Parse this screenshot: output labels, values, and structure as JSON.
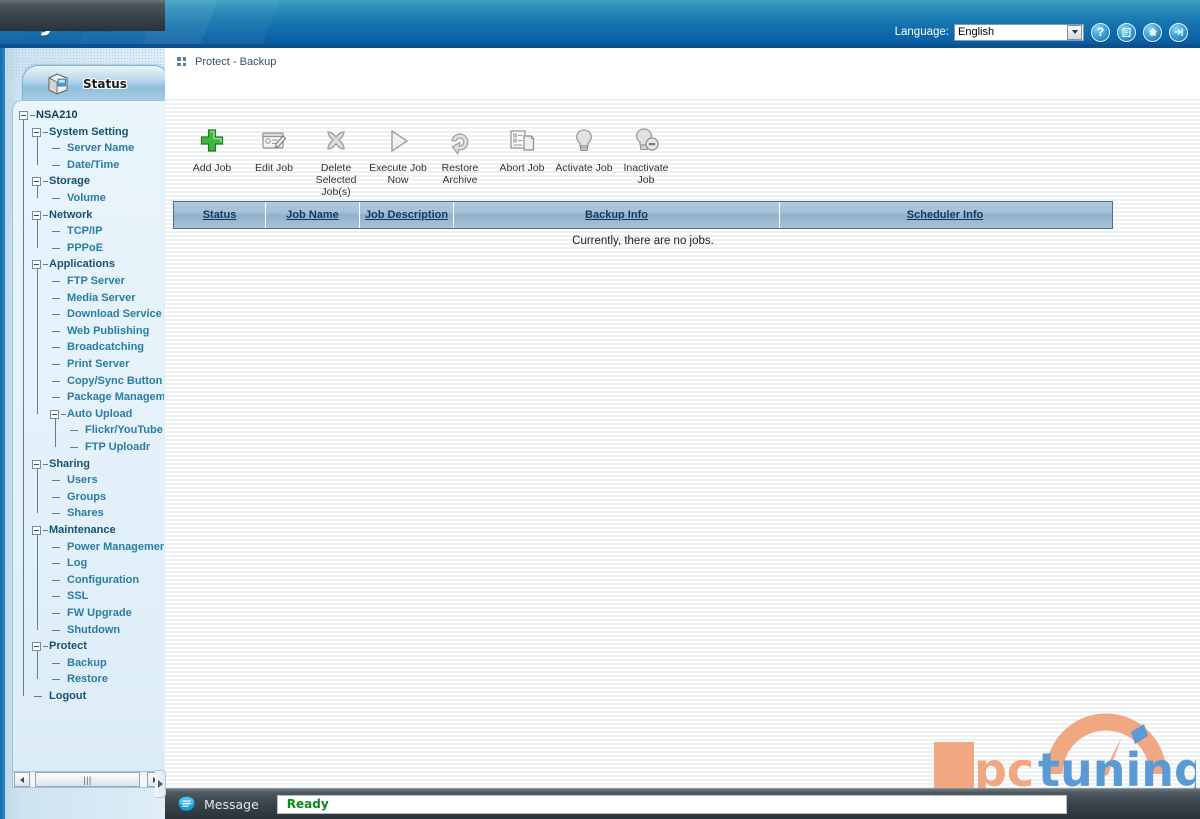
{
  "header": {
    "logo": "ZyXEL",
    "language_label": "Language:",
    "language_value": "English",
    "icons": [
      {
        "name": "help-icon",
        "glyph": "?"
      },
      {
        "name": "manual-icon",
        "glyph": "☰"
      },
      {
        "name": "home-icon",
        "glyph": "⌂"
      },
      {
        "name": "logout-icon",
        "glyph": "→"
      }
    ]
  },
  "sidebar": {
    "status_tab_label": "Status",
    "tree": [
      {
        "label": "NSA210",
        "level": 0,
        "expandable": true
      },
      {
        "label": "System Setting",
        "level": 1,
        "expandable": true
      },
      {
        "label": "Server Name",
        "level": 2,
        "expandable": false
      },
      {
        "label": "Date/Time",
        "level": 2,
        "expandable": false
      },
      {
        "label": "Storage",
        "level": 1,
        "expandable": true
      },
      {
        "label": "Volume",
        "level": 2,
        "expandable": false
      },
      {
        "label": "Network",
        "level": 1,
        "expandable": true
      },
      {
        "label": "TCP/IP",
        "level": 2,
        "expandable": false
      },
      {
        "label": "PPPoE",
        "level": 2,
        "expandable": false
      },
      {
        "label": "Applications",
        "level": 1,
        "expandable": true
      },
      {
        "label": "FTP Server",
        "level": 2,
        "expandable": false
      },
      {
        "label": "Media Server",
        "level": 2,
        "expandable": false
      },
      {
        "label": "Download Service",
        "level": 2,
        "expandable": false
      },
      {
        "label": "Web Publishing",
        "level": 2,
        "expandable": false
      },
      {
        "label": "Broadcatching",
        "level": 2,
        "expandable": false
      },
      {
        "label": "Print Server",
        "level": 2,
        "expandable": false
      },
      {
        "label": "Copy/Sync Button",
        "level": 2,
        "expandable": false
      },
      {
        "label": "Package Management",
        "level": 2,
        "expandable": false
      },
      {
        "label": "Auto Upload",
        "level": 2,
        "expandable": true
      },
      {
        "label": "Flickr/YouTube",
        "level": 3,
        "expandable": false
      },
      {
        "label": "FTP Uploadr",
        "level": 3,
        "expandable": false
      },
      {
        "label": "Sharing",
        "level": 1,
        "expandable": true
      },
      {
        "label": "Users",
        "level": 2,
        "expandable": false
      },
      {
        "label": "Groups",
        "level": 2,
        "expandable": false
      },
      {
        "label": "Shares",
        "level": 2,
        "expandable": false
      },
      {
        "label": "Maintenance",
        "level": 1,
        "expandable": true
      },
      {
        "label": "Power Management",
        "level": 2,
        "expandable": false
      },
      {
        "label": "Log",
        "level": 2,
        "expandable": false
      },
      {
        "label": "Configuration",
        "level": 2,
        "expandable": false
      },
      {
        "label": "SSL",
        "level": 2,
        "expandable": false
      },
      {
        "label": "FW Upgrade",
        "level": 2,
        "expandable": false
      },
      {
        "label": "Shutdown",
        "level": 2,
        "expandable": false
      },
      {
        "label": "Protect",
        "level": 1,
        "expandable": true
      },
      {
        "label": "Backup",
        "level": 2,
        "expandable": false
      },
      {
        "label": "Restore",
        "level": 2,
        "expandable": false
      },
      {
        "label": "Logout",
        "level": 1,
        "expandable": false
      }
    ],
    "scrollbar_grip": "|||"
  },
  "main": {
    "breadcrumb": "Protect - Backup",
    "page_title": "Backup",
    "toolbar": [
      {
        "name": "add-job",
        "label": "Add Job",
        "icon": "plus-icon"
      },
      {
        "name": "edit-job",
        "label": "Edit Job",
        "icon": "pencil-window-icon"
      },
      {
        "name": "delete-selected-jobs",
        "label": "Delete Selected Job(s)",
        "icon": "x-cross-icon"
      },
      {
        "name": "execute-job-now",
        "label": "Execute Job Now",
        "icon": "play-triangle-icon"
      },
      {
        "name": "restore-archive",
        "label": "Restore Archive",
        "icon": "undo-arrow-icon"
      },
      {
        "name": "abort-job",
        "label": "Abort Job",
        "icon": "document-pages-icon"
      },
      {
        "name": "activate-job",
        "label": "Activate Job",
        "icon": "lightbulb-icon"
      },
      {
        "name": "inactivate-job",
        "label": "Inactivate Job",
        "icon": "lightbulb-minus-icon"
      }
    ],
    "table": {
      "columns": [
        "Status",
        "Job Name",
        "Job Description",
        "Backup Info",
        "Scheduler Info"
      ],
      "rows": [],
      "empty_message": "Currently, there are no jobs."
    }
  },
  "statusbar": {
    "label": "Message",
    "value": "Ready",
    "value_color": "#0a8a1a"
  },
  "watermark": {
    "text_pc": "pc",
    "text_tuning": "tuning",
    "orange": "#f0a882",
    "blue": "#5b9bd5"
  }
}
